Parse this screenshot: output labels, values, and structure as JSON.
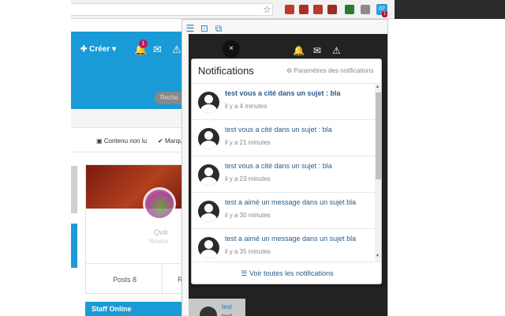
{
  "browser": {
    "extension_badge_text": "07",
    "extension_count": "1",
    "overflow_text": "ons"
  },
  "forum": {
    "create_label": "Créer",
    "bell_badge": "1",
    "search_placeholder": "Reche",
    "filter_unread": "Contenu non lu",
    "filter_mark": "Marqu",
    "posts_label": "Posts 8",
    "posts_right_label": "R",
    "staff_online": "Staff Online",
    "side_user_name": "test",
    "side_user_sub": "test",
    "accent_color": "#1a9ad6"
  },
  "panel": {
    "title": "Notifications",
    "settings_label": "Paramètres des notifications",
    "see_all_label": "Voir toutes les notifications",
    "close_label": "×",
    "notifications": [
      {
        "text": "test vous a cité dans un sujet : bla",
        "time": "il y a 4 minutes",
        "unread": true
      },
      {
        "text": "test vous a cité dans un sujet : bla",
        "time": "il y a 21 minutes",
        "unread": false
      },
      {
        "text": "test vous a cité dans un sujet : bla",
        "time": "il y a 23 minutes",
        "unread": false
      },
      {
        "text": "test a aimé un message dans un sujet bla",
        "time": "il y a 30 minutes",
        "unread": false
      },
      {
        "text": "test a aimé un message dans un sujet bla",
        "time": "il y a 35 minutes",
        "unread": false
      }
    ]
  }
}
